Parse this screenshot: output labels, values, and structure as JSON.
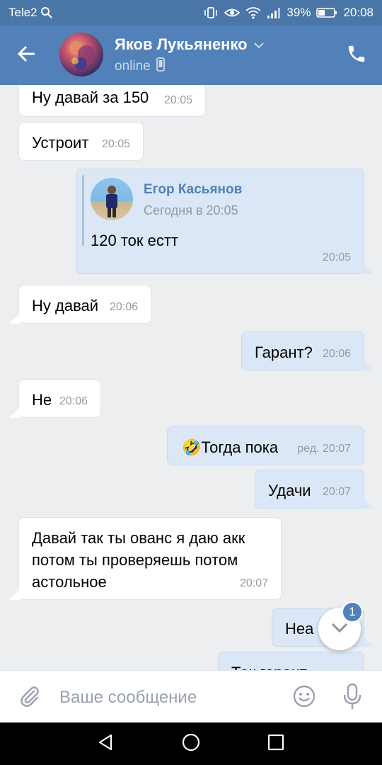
{
  "status_bar": {
    "carrier": "Tele2",
    "battery": "39%",
    "time": "20:08"
  },
  "header": {
    "name": "Яков Лукьяненко",
    "status": "online"
  },
  "messages": [
    {
      "text": "Ну давай за 150",
      "time": "20:05"
    },
    {
      "text": "Устроит",
      "time": "20:05"
    },
    {
      "forwarded": {
        "author": "Егор Касьянов",
        "date": "Сегодня в 20:05",
        "text": "120 ток естт"
      },
      "time": "20:05"
    },
    {
      "text": "Ну давай",
      "time": "20:06"
    },
    {
      "text": "Гарант?",
      "time": "20:06"
    },
    {
      "text": "Не",
      "time": "20:06"
    },
    {
      "emoji": "🤣",
      "text": "Тогда пока",
      "time": "ред. 20:07"
    },
    {
      "text": "Удачи",
      "time": "20:07"
    },
    {
      "text": "Давай так ты ованс я даю акк\nпотом ты проверяешь потом\nастольное",
      "time": "20:07"
    },
    {
      "text": "Неа"
    },
    {
      "text": "Так гарант"
    }
  ],
  "scroll_down": {
    "unread_count": "1"
  },
  "composer": {
    "placeholder": "Ваше сообщение"
  },
  "icons": {
    "back": "arrow-left-icon",
    "call": "phone-icon",
    "attach": "paperclip-icon",
    "emoji": "smile-icon",
    "mic": "microphone-icon"
  },
  "colors": {
    "header": "#5181b8",
    "statusbar": "#4a76a8",
    "outgoing_bubble": "#dbe7f7",
    "incoming_bubble": "#ffffff",
    "background": "#edeef0"
  }
}
